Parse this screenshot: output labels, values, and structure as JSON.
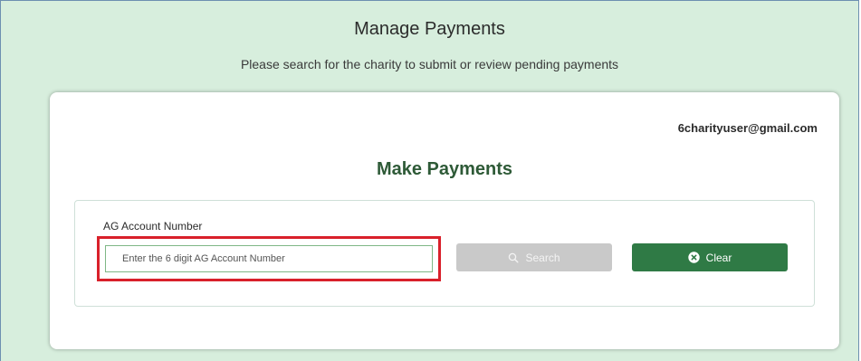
{
  "page": {
    "title": "Manage Payments",
    "subtitle": "Please search for the charity to submit or review pending payments"
  },
  "card": {
    "user_email": "6charityuser@gmail.com",
    "title": "Make Payments"
  },
  "search": {
    "field_label": "AG Account Number",
    "input_value": "",
    "input_placeholder": "Enter the 6 digit AG Account Number",
    "search_label": "Search",
    "clear_label": "Clear"
  },
  "icons": {
    "search": "search-icon",
    "clear": "close-circle-icon"
  },
  "colors": {
    "background": "#d7eedd",
    "title_green": "#2e5a37",
    "clear_button": "#2f7a45",
    "search_button_disabled": "#c9c9c9",
    "highlight_red": "#d9202a",
    "input_border": "#7fb786"
  }
}
